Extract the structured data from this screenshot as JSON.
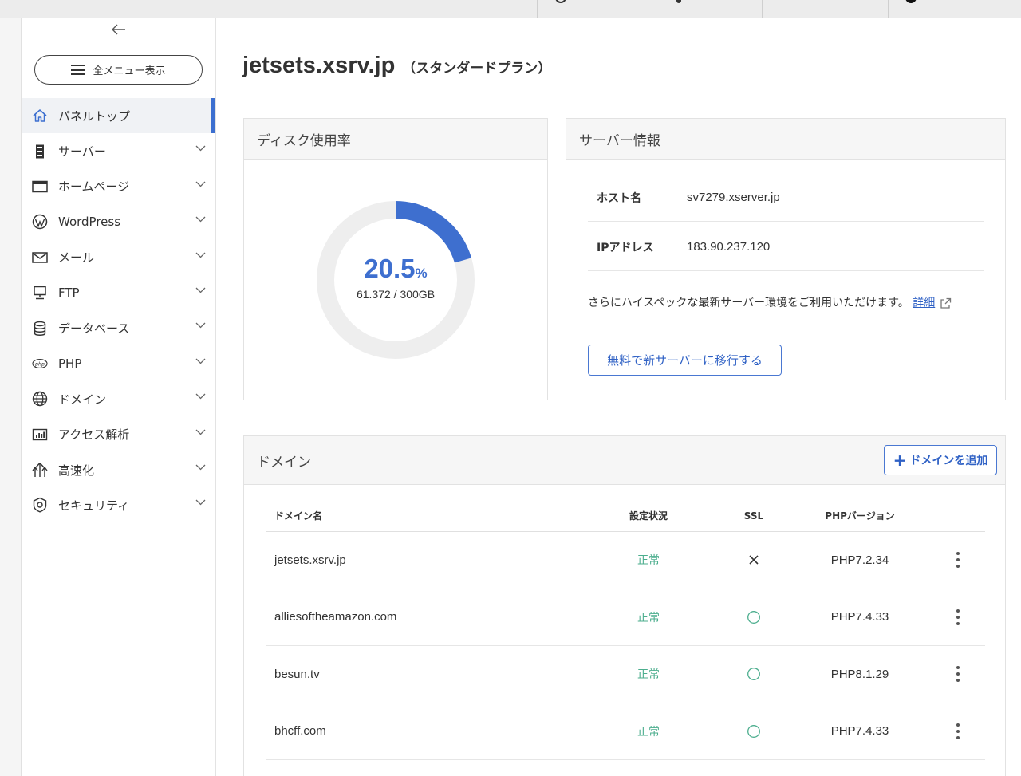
{
  "sidebar": {
    "menu_button": "全メニュー表示",
    "items": [
      {
        "label": "パネルトップ",
        "icon": "home-icon",
        "active": true
      },
      {
        "label": "サーバー",
        "icon": "server-icon"
      },
      {
        "label": "ホームページ",
        "icon": "window-icon"
      },
      {
        "label": "WordPress",
        "icon": "wordpress-icon"
      },
      {
        "label": "メール",
        "icon": "mail-icon"
      },
      {
        "label": "FTP",
        "icon": "monitor-icon"
      },
      {
        "label": "データベース",
        "icon": "database-icon"
      },
      {
        "label": "PHP",
        "icon": "php-icon"
      },
      {
        "label": "ドメイン",
        "icon": "globe-icon"
      },
      {
        "label": "アクセス解析",
        "icon": "bar-chart-icon"
      },
      {
        "label": "高速化",
        "icon": "speed-up-icon"
      },
      {
        "label": "セキュリティ",
        "icon": "shield-icon"
      }
    ]
  },
  "header": {
    "domain": "jetsets.xsrv.jp",
    "plan": "（スタンダードプラン）"
  },
  "disk": {
    "title": "ディスク使用率",
    "percent_value": "20.5",
    "percent_unit": "%",
    "usage": "61.372 / 300GB",
    "fraction": 0.205
  },
  "server_info": {
    "title": "サーバー情報",
    "rows": [
      {
        "key": "ホスト名",
        "value": "sv7279.xserver.jp"
      },
      {
        "key": "IPアドレス",
        "value": "183.90.237.120"
      }
    ],
    "promo_text": "さらにハイスペックな最新サーバー環境をご利用いただけます。",
    "promo_link": "詳細",
    "migrate_button": "無料で新サーバーに移行する"
  },
  "domains": {
    "title": "ドメイン",
    "add_button": "ドメインを追加",
    "columns": {
      "name": "ドメイン名",
      "status": "設定状況",
      "ssl": "SSL",
      "php": "PHPバージョン"
    },
    "rows": [
      {
        "name": "jetsets.xsrv.jp",
        "status": "正常",
        "ssl": "off",
        "php": "PHP7.2.34"
      },
      {
        "name": "alliesoftheamazon.com",
        "status": "正常",
        "ssl": "on",
        "php": "PHP7.4.33"
      },
      {
        "name": "besun.tv",
        "status": "正常",
        "ssl": "on",
        "php": "PHP8.1.29"
      },
      {
        "name": "bhcff.com",
        "status": "正常",
        "ssl": "on",
        "php": "PHP7.4.33"
      }
    ]
  },
  "colors": {
    "accent": "#3e6fcf",
    "status_ok": "#4cae8e",
    "donut_track": "#eeeeee"
  }
}
